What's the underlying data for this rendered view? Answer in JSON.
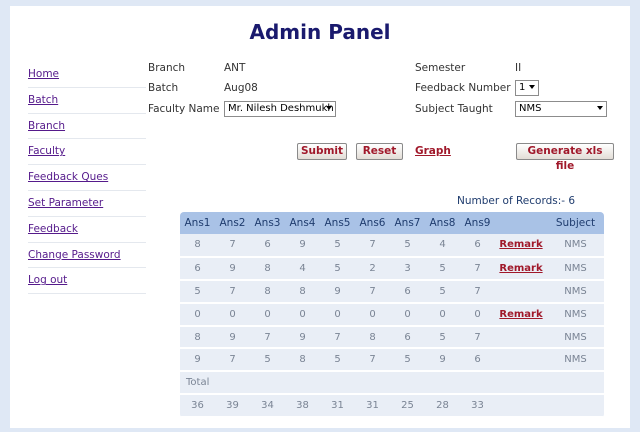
{
  "header": {
    "title": "Admin Panel"
  },
  "sidebar": {
    "items": [
      {
        "label": "Home"
      },
      {
        "label": "Batch"
      },
      {
        "label": "Branch"
      },
      {
        "label": "Faculty"
      },
      {
        "label": "Feedback Ques"
      },
      {
        "label": "Set Parameter"
      },
      {
        "label": "Feedback"
      },
      {
        "label": "Change Password"
      },
      {
        "label": "Log out"
      }
    ]
  },
  "form": {
    "branch_label": "Branch",
    "branch_value": "ANT",
    "batch_label": "Batch",
    "batch_value": "Aug08",
    "faculty_label": "Faculty Name",
    "faculty_value": "Mr. Nilesh Deshmukh",
    "semester_label": "Semester",
    "semester_value": "II",
    "feedback_number_label": "Feedback Number",
    "feedback_number_value": "1",
    "subject_label": "Subject Taught",
    "subject_value": "NMS"
  },
  "actions": {
    "submit": "Submit",
    "reset": "Reset",
    "graph": "Graph",
    "generate": "Generate xls file"
  },
  "records": {
    "label": "Number of Records:- 6"
  },
  "table": {
    "headers": [
      "Ans1",
      "Ans2",
      "Ans3",
      "Ans4",
      "Ans5",
      "Ans6",
      "Ans7",
      "Ans8",
      "Ans9",
      "",
      "Subject"
    ],
    "rows": [
      {
        "cells": [
          "8",
          "7",
          "6",
          "9",
          "5",
          "7",
          "5",
          "4",
          "6"
        ],
        "remark": "Remark",
        "subject": "NMS"
      },
      {
        "cells": [
          "6",
          "9",
          "8",
          "4",
          "5",
          "2",
          "3",
          "5",
          "7"
        ],
        "remark": "Remark",
        "subject": "NMS"
      },
      {
        "cells": [
          "5",
          "7",
          "8",
          "8",
          "9",
          "7",
          "6",
          "5",
          "7"
        ],
        "remark": "",
        "subject": "NMS"
      },
      {
        "cells": [
          "0",
          "0",
          "0",
          "0",
          "0",
          "0",
          "0",
          "0",
          "0"
        ],
        "remark": "Remark",
        "subject": "NMS"
      },
      {
        "cells": [
          "8",
          "9",
          "7",
          "9",
          "7",
          "8",
          "6",
          "5",
          "7"
        ],
        "remark": "",
        "subject": "NMS"
      },
      {
        "cells": [
          "9",
          "7",
          "5",
          "8",
          "5",
          "7",
          "5",
          "9",
          "6"
        ],
        "remark": "",
        "subject": "NMS"
      }
    ],
    "total_label": "Total",
    "totals": [
      "36",
      "39",
      "34",
      "38",
      "31",
      "31",
      "25",
      "28",
      "33"
    ]
  }
}
